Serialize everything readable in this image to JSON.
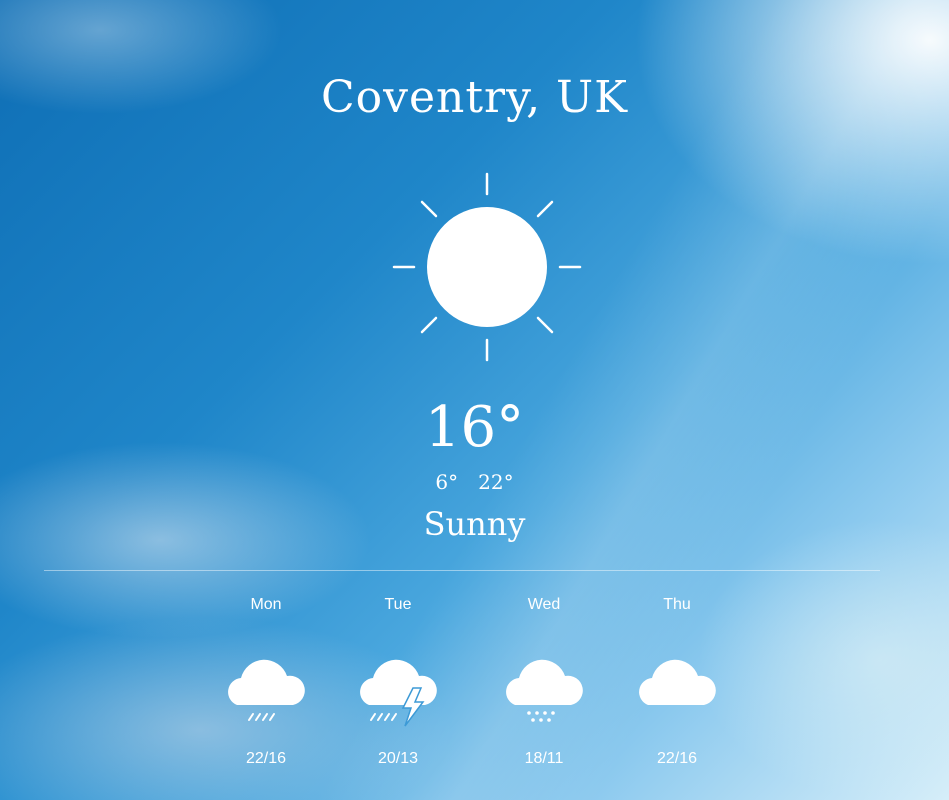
{
  "location": "Coventry, UK",
  "current": {
    "temperature": "16°",
    "low": "6°",
    "high": "22°",
    "condition": "Sunny",
    "icon": "sun-icon"
  },
  "forecast": [
    {
      "day": "Mon",
      "range": "22/16",
      "icon": "rain-cloud-icon"
    },
    {
      "day": "Tue",
      "range": "20/13",
      "icon": "thunderstorm-cloud-icon"
    },
    {
      "day": "Wed",
      "range": "18/11",
      "icon": "snow-cloud-icon"
    },
    {
      "day": "Thu",
      "range": "22/16",
      "icon": "cloud-icon"
    }
  ],
  "colors": {
    "text": "#ffffff",
    "sky": "#1f86c9"
  }
}
